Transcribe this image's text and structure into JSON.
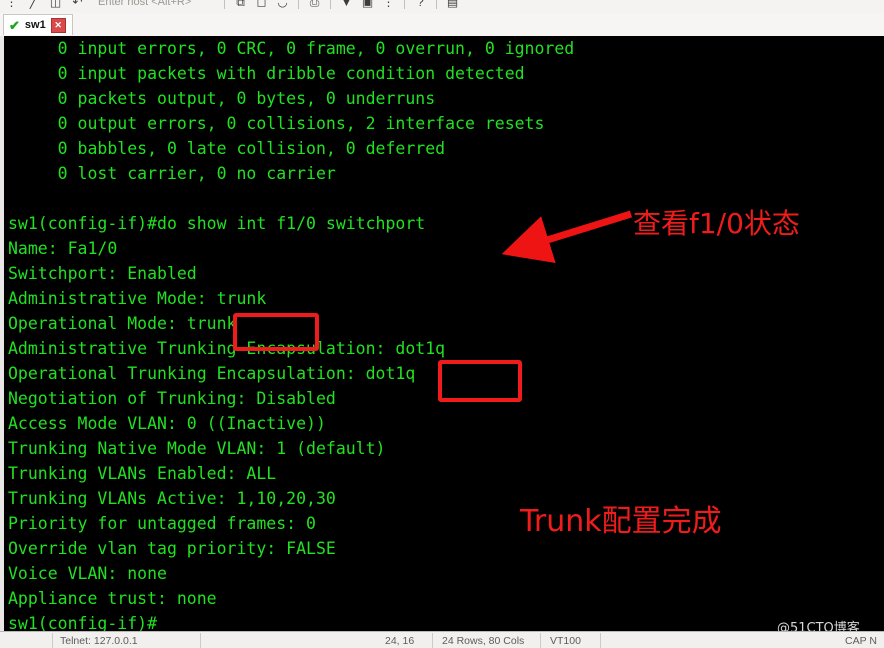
{
  "toolbar": {
    "host_placeholder": "Enter host <Alt+R>",
    "icons_left": [
      "menu-icon",
      "quick-connect-icon",
      "session-icon",
      "reconnect-icon"
    ],
    "icons_right": [
      "copy-icon",
      "paste-icon",
      "find-icon",
      "print-icon",
      "filter-icon",
      "log-icon",
      "info-icon",
      "help-icon",
      "notes-icon"
    ]
  },
  "tab": {
    "label": "sw1",
    "check_glyph": "✔",
    "close_glyph": "✕"
  },
  "terminal": {
    "lines": [
      "     0 input errors, 0 CRC, 0 frame, 0 overrun, 0 ignored",
      "     0 input packets with dribble condition detected",
      "     0 packets output, 0 bytes, 0 underruns",
      "     0 output errors, 0 collisions, 2 interface resets",
      "     0 babbles, 0 late collision, 0 deferred",
      "     0 lost carrier, 0 no carrier",
      "",
      "sw1(config-if)#do show int f1/0 switchport",
      "Name: Fa1/0",
      "Switchport: Enabled",
      "Administrative Mode: trunk",
      "Operational Mode: trunk",
      "Administrative Trunking Encapsulation: dot1q",
      "Operational Trunking Encapsulation: dot1q",
      "Negotiation of Trunking: Disabled",
      "Access Mode VLAN: 0 ((Inactive))",
      "Trunking Native Mode VLAN: 1 (default)",
      "Trunking VLANs Enabled: ALL",
      "Trunking VLANs Active: 1,10,20,30",
      "Priority for untagged frames: 0",
      "Override vlan tag priority: FALSE",
      "Voice VLAN: none",
      "Appliance trust: none",
      "sw1(config-if)#"
    ]
  },
  "annotations": {
    "color": "#f01b1b",
    "note_view_status": "查看f1/0状态",
    "note_trunk_done": "Trunk配置完成",
    "box_trunk_target": "trunk",
    "box_dot1q_target": "dot1q",
    "arrow_name": "red-arrow-pointing-to-command"
  },
  "watermark": {
    "text": "@51CTO博客"
  },
  "statusbar": {
    "connection": "Telnet: 127.0.0.1",
    "cursor": "24, 16",
    "size": "24 Rows, 80 Cols",
    "emulation": "VT100",
    "caps": "CAP N"
  }
}
